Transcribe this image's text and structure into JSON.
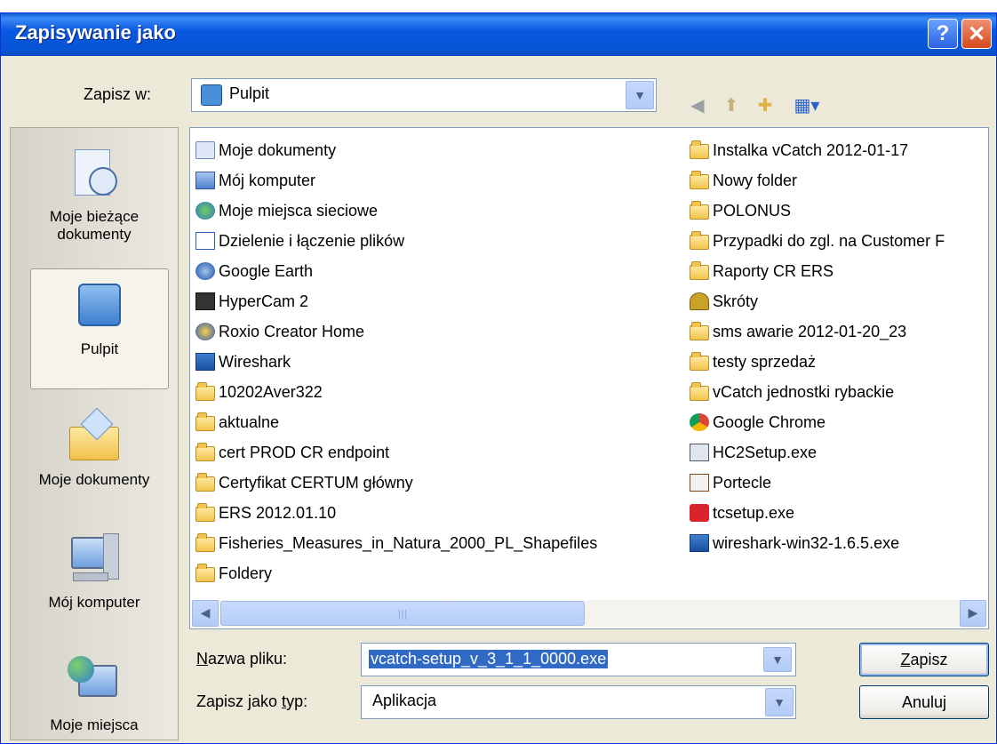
{
  "dialog": {
    "title": "Zapisywanie jako"
  },
  "toolbar": {
    "save_in_label": "Zapisz w:",
    "location": "Pulpit"
  },
  "places": [
    {
      "label": "Moje bieżące dokumenty",
      "icon": "recent-documents-icon"
    },
    {
      "label": "Pulpit",
      "icon": "desktop-icon",
      "selected": true
    },
    {
      "label": "Moje dokumenty",
      "icon": "my-documents-icon"
    },
    {
      "label": "Mój komputer",
      "icon": "my-computer-icon"
    },
    {
      "label": "Moje miejsca",
      "icon": "network-places-icon"
    }
  ],
  "files_col1": [
    {
      "name": "Moje dokumenty",
      "icon": "my-documents-icon"
    },
    {
      "name": "Mój komputer",
      "icon": "my-computer-icon"
    },
    {
      "name": "Moje miejsca sieciowe",
      "icon": "network-icon"
    },
    {
      "name": "Dzielenie i łączenie plików",
      "icon": "shortcut-icon"
    },
    {
      "name": "Google Earth",
      "icon": "google-earth-icon"
    },
    {
      "name": "HyperCam 2",
      "icon": "hypercam-icon"
    },
    {
      "name": "Roxio Creator Home",
      "icon": "roxio-icon"
    },
    {
      "name": "Wireshark",
      "icon": "wireshark-icon"
    },
    {
      "name": "10202Aver322",
      "icon": "folder-icon"
    },
    {
      "name": "aktualne",
      "icon": "folder-icon"
    },
    {
      "name": "cert PROD CR endpoint",
      "icon": "folder-icon"
    },
    {
      "name": "Certyfikat CERTUM główny",
      "icon": "folder-icon"
    },
    {
      "name": "ERS 2012.01.10",
      "icon": "folder-icon"
    },
    {
      "name": "Fisheries_Measures_in_Natura_2000_PL_Shapefiles",
      "icon": "folder-icon"
    },
    {
      "name": "Foldery",
      "icon": "folder-icon"
    }
  ],
  "files_col2": [
    {
      "name": "Instalka vCatch 2012-01-17",
      "icon": "folder-icon"
    },
    {
      "name": "Nowy folder",
      "icon": "folder-icon"
    },
    {
      "name": "POLONUS",
      "icon": "folder-icon"
    },
    {
      "name": "Przypadki do zgl. na Customer F",
      "icon": "folder-icon"
    },
    {
      "name": "Raporty CR ERS",
      "icon": "folder-icon"
    },
    {
      "name": "Skróty",
      "icon": "shortcuts-folder-icon"
    },
    {
      "name": "sms awarie 2012-01-20_23",
      "icon": "folder-icon"
    },
    {
      "name": "testy sprzedaż",
      "icon": "folder-icon"
    },
    {
      "name": "vCatch jednostki rybackie",
      "icon": "folder-icon"
    },
    {
      "name": "Google Chrome",
      "icon": "chrome-icon"
    },
    {
      "name": "HC2Setup.exe",
      "icon": "setup-icon"
    },
    {
      "name": "Portecle",
      "icon": "portecle-icon"
    },
    {
      "name": "tcsetup.exe",
      "icon": "tcsetup-icon"
    },
    {
      "name": "wireshark-win32-1.6.5.exe",
      "icon": "wireshark-icon"
    }
  ],
  "filename": {
    "label_prefix": "N",
    "label_rest": "azwa pliku:",
    "value": "vcatch-setup_v_3_1_1_0000.exe"
  },
  "filetype": {
    "label_prefix": "Zapisz jako ",
    "label_key": "t",
    "label_rest": "yp:",
    "value": "Aplikacja"
  },
  "buttons": {
    "save_key": "Z",
    "save_rest": "apisz",
    "cancel": "Anuluj"
  },
  "colors": {
    "titlebar": "#0858e0",
    "dialog_bg": "#ece9d8",
    "selection": "#316ac5"
  }
}
